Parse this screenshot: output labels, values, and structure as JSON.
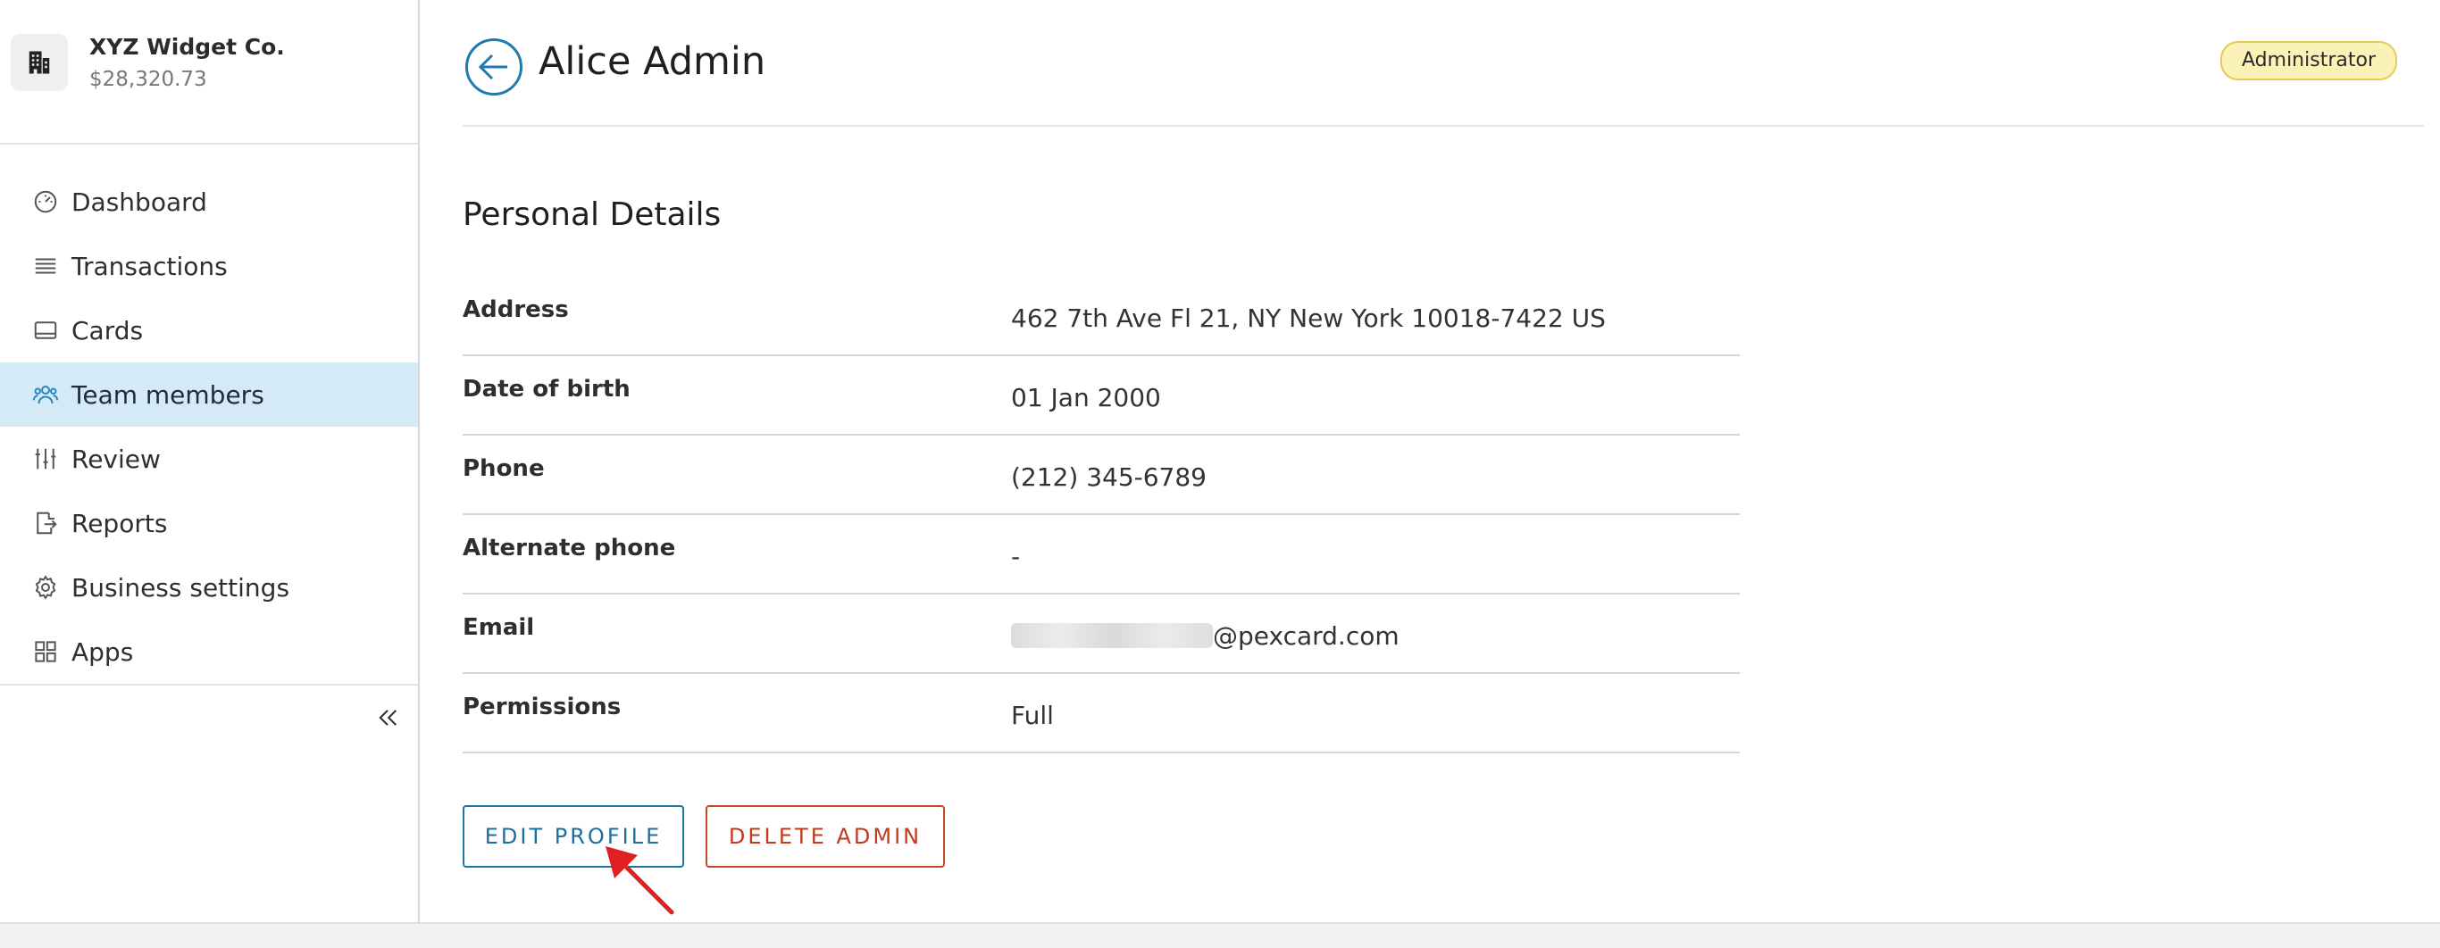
{
  "business": {
    "name": "XYZ Widget Co.",
    "balance": "$28,320.73"
  },
  "nav": [
    {
      "label": "Dashboard",
      "icon": "speedometer-icon",
      "active": false
    },
    {
      "label": "Transactions",
      "icon": "list-icon",
      "active": false
    },
    {
      "label": "Cards",
      "icon": "card-icon",
      "active": false
    },
    {
      "label": "Team members",
      "icon": "team-icon",
      "active": true
    },
    {
      "label": "Review",
      "icon": "sliders-icon",
      "active": false
    },
    {
      "label": "Reports",
      "icon": "export-icon",
      "active": false
    },
    {
      "label": "Business settings",
      "icon": "gear-icon",
      "active": false
    },
    {
      "label": "Apps",
      "icon": "grid-icon",
      "active": false
    }
  ],
  "header": {
    "title": "Alice Admin",
    "role_badge": "Administrator"
  },
  "section": {
    "title": "Personal Details"
  },
  "details": {
    "address": {
      "label": "Address",
      "value": "462 7th Ave Fl 21, NY New York 10018-7422 US"
    },
    "dob": {
      "label": "Date of birth",
      "value": "01 Jan 2000"
    },
    "phone": {
      "label": "Phone",
      "value": "(212) 345-6789"
    },
    "alt_phone": {
      "label": "Alternate phone",
      "value": "-"
    },
    "email": {
      "label": "Email",
      "value_suffix": "@pexcard.com"
    },
    "permissions": {
      "label": "Permissions",
      "value": "Full"
    }
  },
  "actions": {
    "edit_label": "EDIT PROFILE",
    "delete_label": "DELETE ADMIN"
  },
  "colors": {
    "accent_blue": "#1976a8",
    "danger_red": "#c9462c",
    "active_nav_bg": "#d4eaf7",
    "badge_bg": "#fbf2b8",
    "annotation_arrow": "#e02020"
  }
}
